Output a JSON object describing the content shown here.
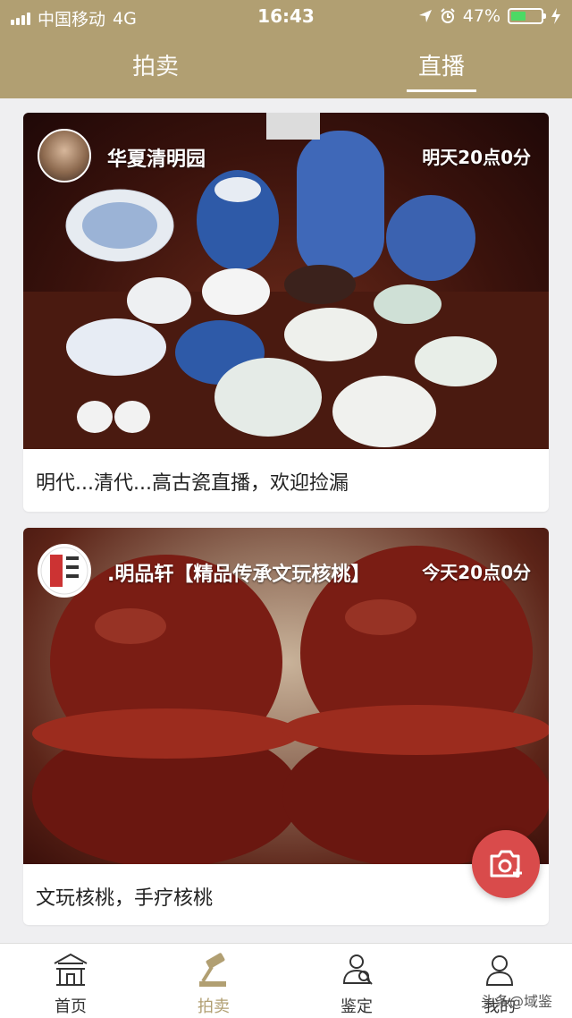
{
  "status_bar": {
    "carrier": "中国移动",
    "network": "4G",
    "time": "16:43",
    "battery": "47%"
  },
  "top_tabs": [
    {
      "label": "拍卖"
    },
    {
      "label": "直播"
    }
  ],
  "cards": [
    {
      "seller": "华夏清明园",
      "live_time": "明天20点0分",
      "caption": "明代...清代...高古瓷直播，欢迎捡漏"
    },
    {
      "seller": ".明品轩【精品传承文玩核桃】",
      "live_time": "今天20点0分",
      "caption": "文玩核桃，手疗核桃"
    }
  ],
  "bottom_tabs": [
    {
      "label": "首页",
      "icon": "pavilion-icon"
    },
    {
      "label": "拍卖",
      "icon": "gavel-icon"
    },
    {
      "label": "鉴定",
      "icon": "magnifier-icon"
    },
    {
      "label": "我的",
      "icon": "user-icon"
    }
  ],
  "watermark": "头条@域鉴",
  "colors": {
    "header": "#b19f72",
    "fab": "#d94b4b",
    "active_tab": "#b19f72"
  }
}
